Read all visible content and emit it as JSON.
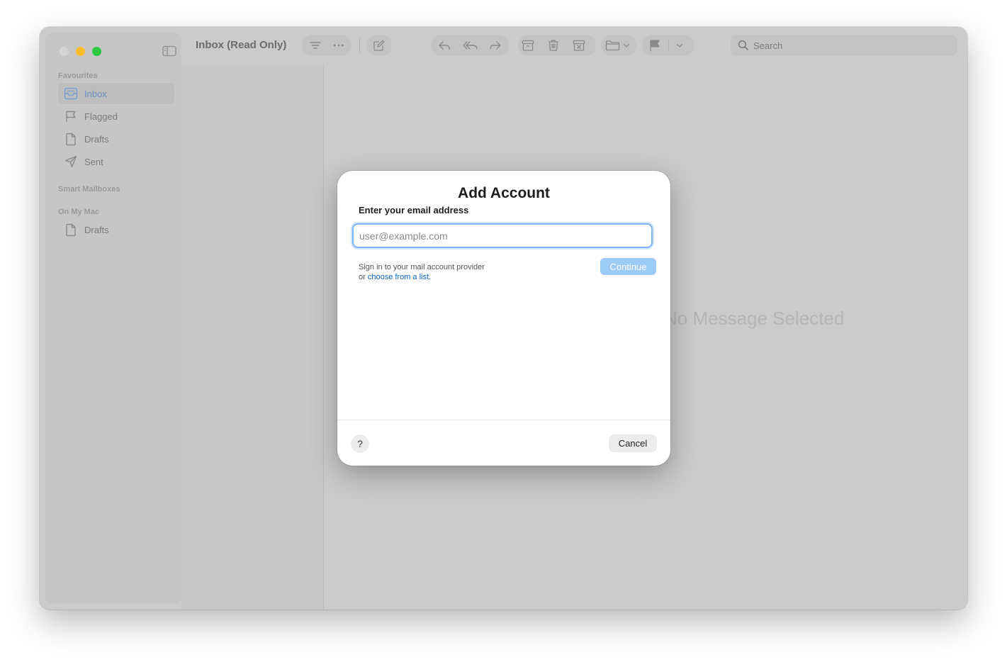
{
  "window": {
    "title": "Inbox (Read Only)",
    "content_placeholder": "No Message Selected"
  },
  "sidebar": {
    "favourites_header": "Favourites",
    "favourites": [
      {
        "label": "Inbox",
        "icon": "inbox-icon",
        "selected": true
      },
      {
        "label": "Flagged",
        "icon": "flag-icon"
      },
      {
        "label": "Drafts",
        "icon": "document-icon"
      },
      {
        "label": "Sent",
        "icon": "paperplane-icon"
      }
    ],
    "smart_header": "Smart Mailboxes",
    "onmymac_header": "On My Mac",
    "onmymac": [
      {
        "label": "Drafts",
        "icon": "document-icon"
      }
    ]
  },
  "toolbar": {
    "search_placeholder": "Search",
    "icons": [
      "filter-icon",
      "more-icon",
      "compose-icon",
      "reply-icon",
      "reply-all-icon",
      "forward-icon",
      "archive-icon",
      "trash-icon",
      "junk-icon",
      "move-folder-icon",
      "flag-icon",
      "chevron-down-icon"
    ]
  },
  "dialog": {
    "title": "Add Account",
    "email_label": "Enter your email address",
    "email_placeholder": "user@example.com",
    "email_value": "",
    "help_line1": "Sign in to your mail account provider",
    "help_or": "or ",
    "help_link": "choose from a list.",
    "continue_label": "Continue",
    "help_button": "?",
    "cancel_label": "Cancel"
  },
  "colors": {
    "accent": "#7eb5f0",
    "continue_disabled": "#9ccbf7",
    "link": "#0a64c8",
    "close": "#d4d4d4",
    "minimize": "#fdbc2c",
    "maximize": "#2ac840"
  }
}
